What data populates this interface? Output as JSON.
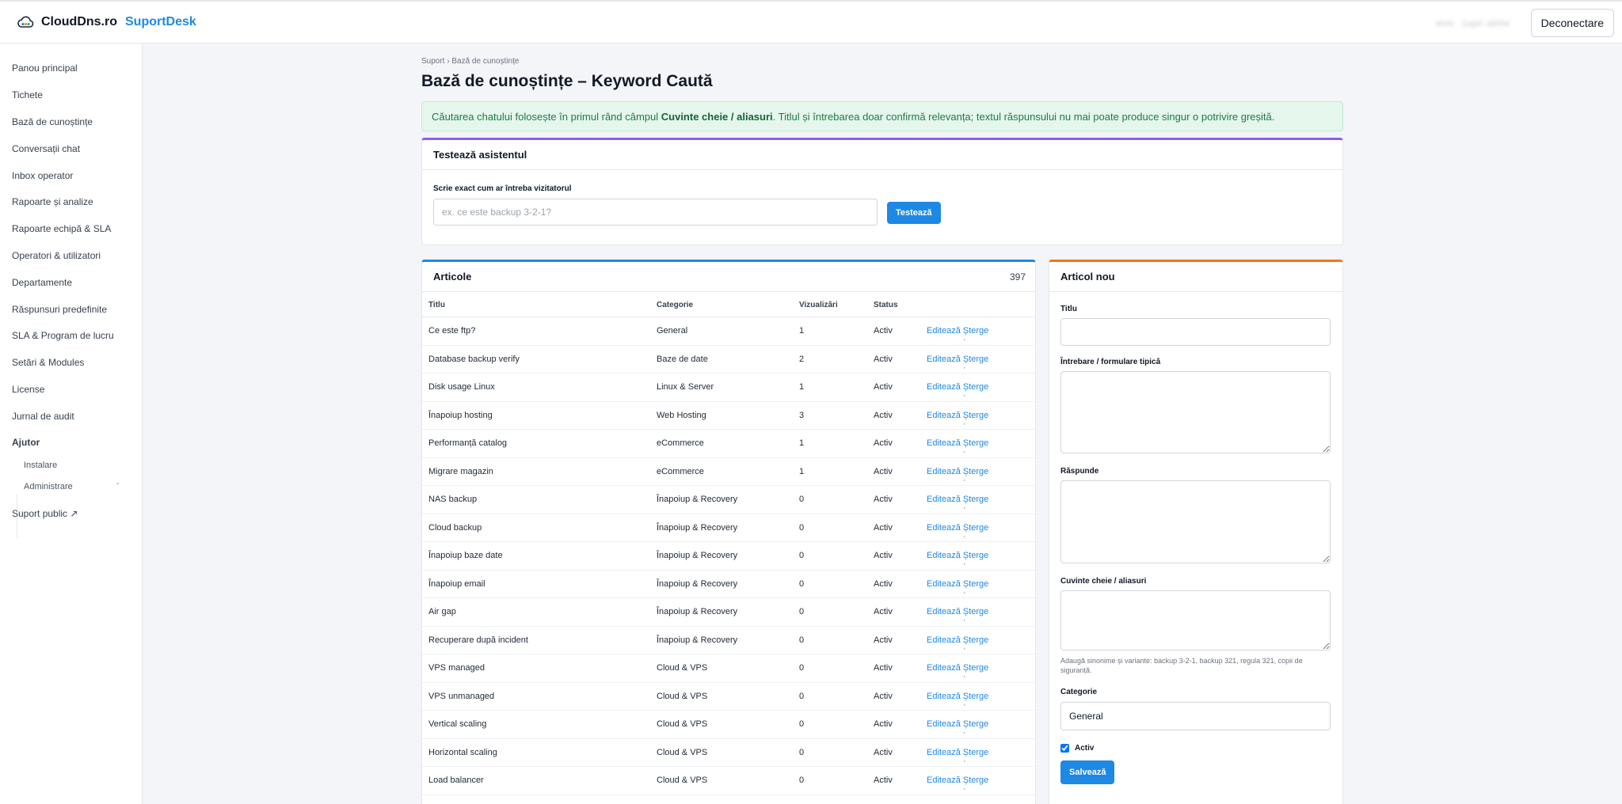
{
  "brand": {
    "name": "CloudDns.ro",
    "product": "SuportDesk"
  },
  "header": {
    "user": "elvis · 1ugsl..abhlw",
    "logout_label": "Deconectare"
  },
  "sidebar": {
    "items": [
      "Panou principal",
      "Tichete",
      "Bază de cunoștințe",
      "Conversații chat",
      "Inbox operator",
      "Rapoarte și analize",
      "Rapoarte echipă & SLA",
      "Operatori & utilizatori",
      "Departamente",
      "Răspunsuri predefinite",
      "SLA & Program de lucru",
      "Setări & Modules",
      "License",
      "Jurnal de audit"
    ],
    "help": {
      "label": "Ajutor",
      "caret": "-",
      "children": [
        "Instalare",
        "Administrare"
      ]
    },
    "public_link": "Suport public ↗"
  },
  "page": {
    "breadcrumb": "Suport › Bază de cunoștințe",
    "title": "Bază de cunoștințe – Keyword Caută",
    "info": {
      "prefix": "Căutarea chatului folosește în primul rând câmpul ",
      "bold": "Cuvinte cheie / aliasuri",
      "suffix": ". Titlul și întrebarea doar confirmă relevanța; textul răspunsului nu mai poate produce singur o potrivire greșită."
    }
  },
  "tester": {
    "title": "Testează asistentul",
    "label": "Scrie exact cum ar întreba vizitatorul",
    "placeholder": "ex. ce este backup 3-2-1?",
    "button": "Testează"
  },
  "articles": {
    "title": "Articole",
    "count": "397",
    "columns": {
      "title": "Titlu",
      "category": "Categorie",
      "views": "Vizualizări",
      "status": "Status"
    },
    "edit_label": "Editează",
    "separator": "·",
    "delete_label": "Șterge",
    "rows": [
      {
        "title": "Ce este ftp?",
        "category": "General",
        "views": "1",
        "status": "Activ"
      },
      {
        "title": "Database backup verify",
        "category": "Baze de date",
        "views": "2",
        "status": "Activ"
      },
      {
        "title": "Disk usage Linux",
        "category": "Linux & Server",
        "views": "1",
        "status": "Activ"
      },
      {
        "title": "Înapoiup hosting",
        "category": "Web Hosting",
        "views": "3",
        "status": "Activ"
      },
      {
        "title": "Performanță catalog",
        "category": "eCommerce",
        "views": "1",
        "status": "Activ"
      },
      {
        "title": "Migrare magazin",
        "category": "eCommerce",
        "views": "1",
        "status": "Activ"
      },
      {
        "title": "NAS backup",
        "category": "Înapoiup & Recovery",
        "views": "0",
        "status": "Activ"
      },
      {
        "title": "Cloud backup",
        "category": "Înapoiup & Recovery",
        "views": "0",
        "status": "Activ"
      },
      {
        "title": "Înapoiup baze date",
        "category": "Înapoiup & Recovery",
        "views": "0",
        "status": "Activ"
      },
      {
        "title": "Înapoiup email",
        "category": "Înapoiup & Recovery",
        "views": "0",
        "status": "Activ"
      },
      {
        "title": "Air gap",
        "category": "Înapoiup & Recovery",
        "views": "0",
        "status": "Activ"
      },
      {
        "title": "Recuperare după incident",
        "category": "Înapoiup & Recovery",
        "views": "0",
        "status": "Activ"
      },
      {
        "title": "VPS managed",
        "category": "Cloud & VPS",
        "views": "0",
        "status": "Activ"
      },
      {
        "title": "VPS unmanaged",
        "category": "Cloud & VPS",
        "views": "0",
        "status": "Activ"
      },
      {
        "title": "Vertical scaling",
        "category": "Cloud & VPS",
        "views": "0",
        "status": "Activ"
      },
      {
        "title": "Horizontal scaling",
        "category": "Cloud & VPS",
        "views": "0",
        "status": "Activ"
      },
      {
        "title": "Load balancer",
        "category": "Cloud & VPS",
        "views": "0",
        "status": "Activ"
      }
    ]
  },
  "new_article": {
    "title": "Articol nou",
    "field_title": "Titlu",
    "field_question": "Întrebare / formulare tipică",
    "field_answer": "Răspunde",
    "field_keywords": "Cuvinte cheie / aliasuri",
    "keywords_help": "Adaugă sinonime și variante: backup 3-2-1, backup 321, regula 321, copii de siguranță.",
    "field_category": "Categorie",
    "category_value": "General",
    "active_label": "Activ",
    "active_checked": true,
    "save_label": "Salvează"
  },
  "colors": {
    "accent": "#1e88e5",
    "tester_border": "#8b5cf6",
    "articles_border": "#1e88e5",
    "new_article_border": "#f97316",
    "info_bg": "#e5f6ec"
  }
}
